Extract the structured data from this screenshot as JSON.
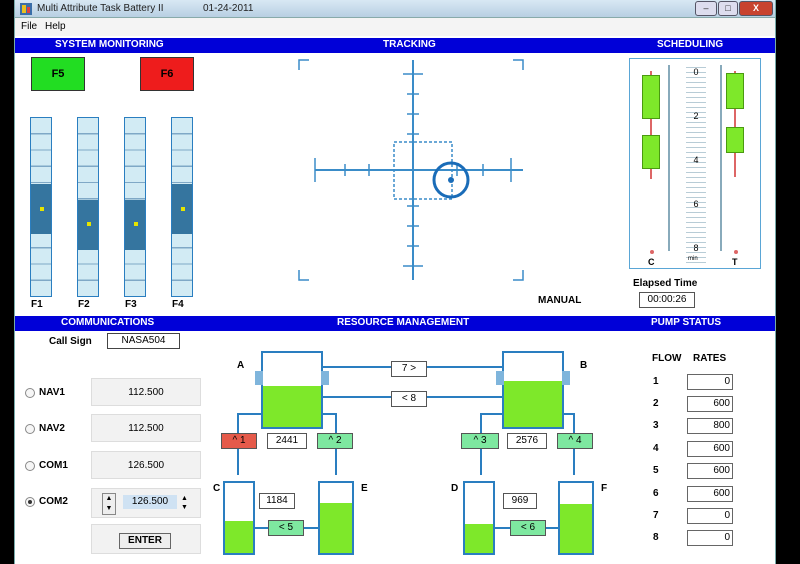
{
  "window": {
    "title": "Multi Attribute Task  Battery II",
    "date": "01-24-2011",
    "min": "–",
    "max": "□",
    "close": "X"
  },
  "menu": [
    "File",
    "Help"
  ],
  "sections": {
    "system_monitoring": "SYSTEM MONITORING",
    "tracking": "TRACKING",
    "scheduling": "SCHEDULING",
    "communications": "COMMUNICATIONS",
    "resource_management": "RESOURCE MANAGEMENT",
    "pump_status": "PUMP STATUS"
  },
  "monitoring": {
    "warnings": [
      {
        "label": "F5",
        "color": "#22dd22"
      },
      {
        "label": "F6",
        "color": "#ee1c1c"
      }
    ],
    "gauges": [
      {
        "label": "F1",
        "level": 0.6
      },
      {
        "label": "F2",
        "level": 0.55
      },
      {
        "label": "F3",
        "level": 0.55
      },
      {
        "label": "F4",
        "level": 0.6
      }
    ]
  },
  "tracking": {
    "mode": "MANUAL"
  },
  "scheduling": {
    "ticks": [
      "0",
      "2",
      "4",
      "6",
      "8"
    ],
    "left_label": "C",
    "right_label": "T",
    "center_label": "min",
    "elapsed_label": "Elapsed Time",
    "elapsed": "00:00:26"
  },
  "communications": {
    "call_sign_label": "Call Sign",
    "call_sign": "NASA504",
    "radios": [
      {
        "label": "NAV1",
        "freq": "112.500",
        "selected": false
      },
      {
        "label": "NAV2",
        "freq": "112.500",
        "selected": false
      },
      {
        "label": "COM1",
        "freq": "126.500",
        "selected": false
      },
      {
        "label": "COM2",
        "freq": "126.500",
        "selected": true
      }
    ],
    "spin_up": "▲",
    "spin_down": "▼",
    "enter_label": "ENTER"
  },
  "resource": {
    "tanks": {
      "A": {
        "label": "A",
        "level": 0.55,
        "amount": "2441"
      },
      "B": {
        "label": "B",
        "level": 0.62,
        "amount": "2576"
      },
      "C": {
        "label": "C",
        "level": 0.46,
        "amount": "1184"
      },
      "D": {
        "label": "D",
        "level": 0.42,
        "amount": "969"
      },
      "E": {
        "label": "E",
        "level": 0.72
      },
      "F": {
        "label": "F",
        "level": 0.7
      }
    },
    "valves": {
      "v1": "^ 1",
      "v2": "^ 2",
      "v3": "^ 3",
      "v4": "^ 4",
      "v5": "< 5",
      "v6": "< 6",
      "v7": "7 >",
      "v8": "< 8"
    }
  },
  "pump_status": {
    "flow_label": "FLOW",
    "rates_label": "RATES",
    "rows": [
      {
        "num": "1",
        "rate": "0"
      },
      {
        "num": "2",
        "rate": "600"
      },
      {
        "num": "3",
        "rate": "800"
      },
      {
        "num": "4",
        "rate": "600"
      },
      {
        "num": "5",
        "rate": "600"
      },
      {
        "num": "6",
        "rate": "600"
      },
      {
        "num": "7",
        "rate": "0"
      },
      {
        "num": "8",
        "rate": "0"
      }
    ]
  }
}
